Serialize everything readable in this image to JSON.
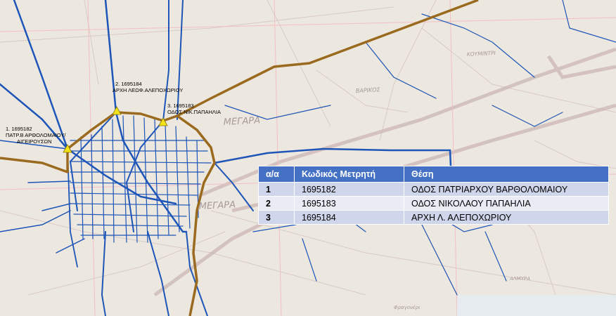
{
  "meters": [
    {
      "label_line1": "1. 1695182",
      "label_line2": "ΠΑΤΡ.Β ΑΡΘΟΛΟΜΑΙΟΥ/",
      "label_line3": "ΑΙΓΕΙΡΟΥΣΩΝ"
    },
    {
      "label_line1": "2. 1695184",
      "label_line2": "ΑΡΧΗ ΛΕΩΦ.ΑΛΕΠΟΧΩΡΙΟΥ",
      "label_line3": ""
    },
    {
      "label_line1": "3. 1695183",
      "label_line2": "ΟΔΟΣ ΝΙΚ.ΠΑΠΑΗΛΙΑ",
      "label_line3": ""
    }
  ],
  "places": {
    "megara_top": "ΜΕΓΑΡΑ",
    "megara_center": "ΜΕΓΑΡΑ",
    "varikos": "ΒΑΡΙΚΟΣ",
    "koumintri": "ΚΟΥΜΙΝΤΡΙ",
    "almyra": "ΑΛΜΥΡΑ",
    "fragoneri": "Φραγονέρι"
  },
  "table": {
    "headers": [
      "α/α",
      "Κωδικός Μετρητή",
      "Θέση"
    ],
    "rows": [
      [
        "1",
        "1695182",
        "ΟΔΟΣ ΠΑΤΡΙΑΡΧΟΥ ΒΑΡΘΟΛΟΜΑΙΟΥ"
      ],
      [
        "2",
        "1695183",
        "ΟΔΟΣ ΝΙΚΟΛΑΟΥ ΠΑΠΑΗΛΙΑ"
      ],
      [
        "3",
        "1695184",
        "ΑΡΧΗ Λ. ΑΛΕΠΟΧΩΡΙΟΥ"
      ]
    ]
  },
  "colors": {
    "pipe": "#1d55b8",
    "boundary": "#9a6a1e",
    "meter_marker": "#f4e21a",
    "table_header": "#4471c4"
  },
  "icons": {
    "meter_marker": "triangle"
  }
}
